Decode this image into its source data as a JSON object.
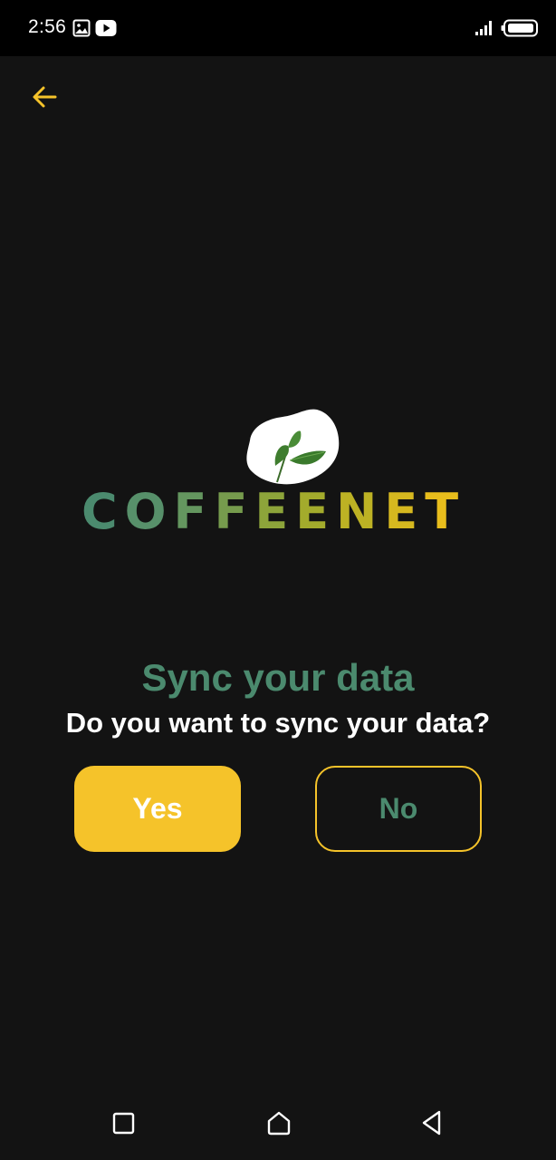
{
  "status_bar": {
    "time": "2:56",
    "icons": [
      "gallery-icon",
      "youtube-icon",
      "signal-icon",
      "battery-icon"
    ]
  },
  "header": {
    "back_icon": "arrow-left-icon"
  },
  "logo": {
    "letters": [
      "C",
      "O",
      "F",
      "F",
      "E",
      "E",
      "N",
      "E",
      "T"
    ],
    "letter_colors": [
      "#4b8a6e",
      "#57906a",
      "#64965f",
      "#769b4d",
      "#8da43a",
      "#a3ab2c",
      "#bdb224",
      "#d6b81f",
      "#e8bd1c"
    ],
    "badge_icon": "leaf-icon"
  },
  "dialog": {
    "title": "Sync your data",
    "message": "Do you want to sync your data?",
    "yes_label": "Yes",
    "no_label": "No"
  },
  "colors": {
    "accent_yellow": "#f5c32a",
    "title_green": "#4b8a6e",
    "background": "#131313"
  },
  "nav_bar": {
    "icons": [
      "recent-apps-icon",
      "home-icon",
      "back-triangle-icon"
    ]
  }
}
